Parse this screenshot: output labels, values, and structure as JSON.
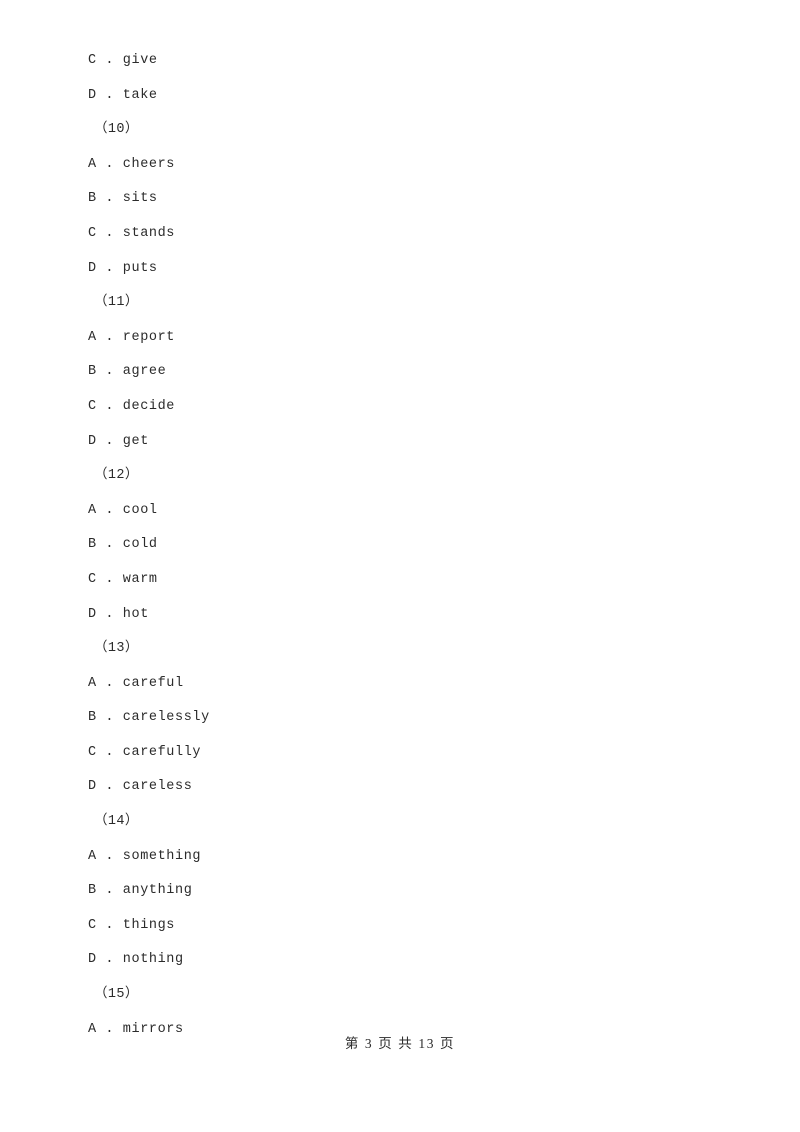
{
  "document": {
    "page_label": "第 3 页 共 13 页",
    "current_page": 3,
    "total_pages": 13,
    "text_color": "#2b2b2b",
    "background_color": "#ffffff"
  },
  "lines": [
    {
      "type": "option",
      "text": "C . give"
    },
    {
      "type": "option",
      "text": "D . take"
    },
    {
      "type": "qnum",
      "text": "（10）"
    },
    {
      "type": "option",
      "text": "A . cheers"
    },
    {
      "type": "option",
      "text": "B . sits"
    },
    {
      "type": "option",
      "text": "C . stands"
    },
    {
      "type": "option",
      "text": "D . puts"
    },
    {
      "type": "qnum",
      "text": "（11）"
    },
    {
      "type": "option",
      "text": "A . report"
    },
    {
      "type": "option",
      "text": "B . agree"
    },
    {
      "type": "option",
      "text": "C . decide"
    },
    {
      "type": "option",
      "text": "D . get"
    },
    {
      "type": "qnum",
      "text": "（12）"
    },
    {
      "type": "option",
      "text": "A . cool"
    },
    {
      "type": "option",
      "text": "B . cold"
    },
    {
      "type": "option",
      "text": "C . warm"
    },
    {
      "type": "option",
      "text": "D . hot"
    },
    {
      "type": "qnum",
      "text": "（13）"
    },
    {
      "type": "option",
      "text": "A . careful"
    },
    {
      "type": "option",
      "text": "B . carelessly"
    },
    {
      "type": "option",
      "text": "C . carefully"
    },
    {
      "type": "option",
      "text": "D . careless"
    },
    {
      "type": "qnum",
      "text": "（14）"
    },
    {
      "type": "option",
      "text": "A . something"
    },
    {
      "type": "option",
      "text": "B . anything"
    },
    {
      "type": "option",
      "text": "C . things"
    },
    {
      "type": "option",
      "text": "D . nothing"
    },
    {
      "type": "qnum",
      "text": "（15）"
    },
    {
      "type": "option",
      "text": "A . mirrors"
    }
  ]
}
